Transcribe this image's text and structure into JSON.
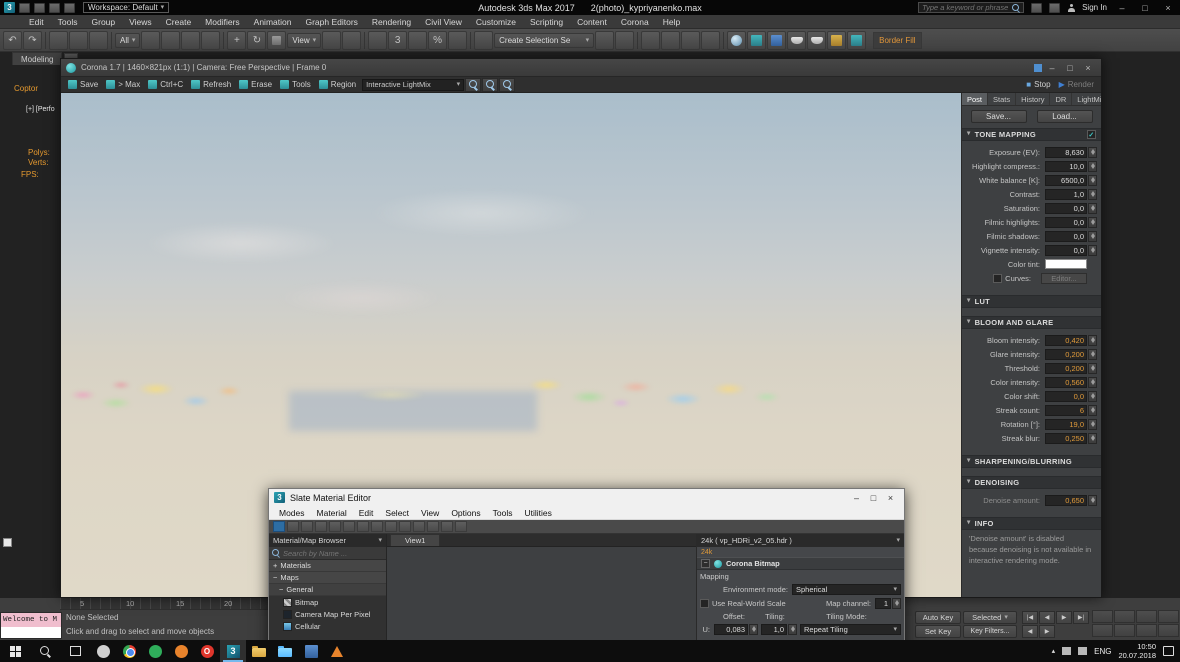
{
  "icons": {
    "minimize": "–",
    "maximize": "□",
    "close": "×",
    "caret_down": "▾",
    "caret_up": "▴",
    "check": "✓",
    "plus": "+",
    "minus": "−",
    "undo": "↶",
    "redo": "↷",
    "play": "▶",
    "stop": "■",
    "first_frame": "|◀",
    "prev_frame": "◀",
    "next_frame": "▶|",
    "move": "+",
    "rotate": "↻"
  },
  "titlebar": {
    "workspace": "Workspace: Default",
    "app_title": "Autodesk 3ds Max 2017",
    "doc_title": "2(photo)_kypriyanenko.max",
    "search_placeholder": "Type a keyword or phrase",
    "sign_in": "Sign In"
  },
  "menubar": {
    "items": [
      "Edit",
      "Tools",
      "Group",
      "Views",
      "Create",
      "Modifiers",
      "Animation",
      "Graph Editors",
      "Rendering",
      "Civil View",
      "Customize",
      "Scripting",
      "Content",
      "Corona",
      "Help"
    ]
  },
  "toolbar": {
    "selection_filter": "All",
    "coord_system": "View",
    "create_selection": "Create Selection Se",
    "border_fill": "Border Fill",
    "snap_label": "3",
    "percent_label": "%"
  },
  "ribbon": {
    "modeling_tab": "Modeling"
  },
  "viewport": {
    "coptor_label": "Coptor",
    "corner_label": "[+] [Perfo",
    "polys_label": "Polys:",
    "verts_label": "Verts:",
    "fps_label": "FPS:"
  },
  "vfb": {
    "title": "Corona 1.7 | 1460×821px (1:1) | Camera: Free Perspective | Frame 0",
    "toolbar": {
      "save": "Save",
      "to_max": "> Max",
      "copy": "Ctrl+C",
      "refresh": "Refresh",
      "erase": "Erase",
      "tools": "Tools",
      "region": "Region",
      "lightmix": "Interactive LightMix",
      "stop": "Stop",
      "render": "Render"
    },
    "tabs": [
      "Post",
      "Stats",
      "History",
      "DR",
      "LightMix"
    ],
    "save_button": "Save...",
    "load_button": "Load...",
    "tone": {
      "title": "TONE MAPPING",
      "rows": [
        {
          "label": "Exposure (EV):",
          "value": "8,630"
        },
        {
          "label": "Highlight compress.:",
          "value": "10,0"
        },
        {
          "label": "White balance [K]:",
          "value": "6500,0"
        },
        {
          "label": "Contrast:",
          "value": "1,0"
        },
        {
          "label": "Saturation:",
          "value": "0,0"
        },
        {
          "label": "Filmic highlights:",
          "value": "0,0"
        },
        {
          "label": "Filmic shadows:",
          "value": "0,0"
        },
        {
          "label": "Vignette intensity:",
          "value": "0,0"
        }
      ],
      "color_tint_label": "Color tint:",
      "curves_label": "Curves:",
      "editor_button": "Editor..."
    },
    "lut": {
      "title": "LUT"
    },
    "bloom": {
      "title": "BLOOM AND GLARE",
      "rows": [
        {
          "label": "Bloom intensity:",
          "value": "0,420"
        },
        {
          "label": "Glare intensity:",
          "value": "0,200"
        },
        {
          "label": "Threshold:",
          "value": "0,200"
        },
        {
          "label": "Color intensity:",
          "value": "0,560"
        },
        {
          "label": "Color shift:",
          "value": "0,0"
        },
        {
          "label": "Streak count:",
          "value": "6"
        },
        {
          "label": "Rotation [°]:",
          "value": "19,0"
        },
        {
          "label": "Streak blur:",
          "value": "0,250"
        }
      ]
    },
    "sharpening": {
      "title": "SHARPENING/BLURRING"
    },
    "denoising": {
      "title": "DENOISING",
      "row": {
        "label": "Denoise amount:",
        "value": "0,650"
      }
    },
    "info": {
      "title": "INFO",
      "text": "'Denoise amount' is disabled because denoising is not available in interactive rendering mode."
    }
  },
  "slate": {
    "title": "Slate Material Editor",
    "menus": [
      "Modes",
      "Material",
      "Edit",
      "Select",
      "View",
      "Options",
      "Tools",
      "Utilities"
    ],
    "view_tab": "View1",
    "browser": {
      "title": "Material/Map Browser",
      "search_placeholder": "Search by Name ...",
      "materials_group": "Materials",
      "maps_group": "Maps",
      "general_group": "General",
      "items": [
        "Bitmap",
        "Camera Map Per Pixel",
        "Cellular"
      ]
    },
    "params": {
      "header": "24k ( vp_HDRi_v2_05.hdr )",
      "node_tag": "24k",
      "rollout": "Corona Bitmap",
      "mapping": "Mapping",
      "env_mode_label": "Environment mode:",
      "env_mode_value": "Spherical",
      "real_world_label": "Use Real-World Scale",
      "map_channel_label": "Map channel:",
      "map_channel_value": "1",
      "offset_label": "Offset:",
      "tiling_label": "Tiling:",
      "tiling_mode_label": "Tiling Mode:",
      "u_label": "U:",
      "u_offset": "0,083",
      "u_tiling": "1,0",
      "u_mode": "Repeat Tiling"
    }
  },
  "statusbar": {
    "listener_text": "Welcome to M",
    "ticks": [
      "5",
      "10",
      "15",
      "20"
    ],
    "selection": "None Selected",
    "prompt": "Click and drag to select and move objects",
    "auto_key": "Auto Key",
    "selected": "Selected",
    "set_key": "Set Key",
    "key_filters": "Key Filters..."
  },
  "taskbar": {
    "lang": "ENG",
    "time": "10:50",
    "date": "20.07.2018"
  }
}
